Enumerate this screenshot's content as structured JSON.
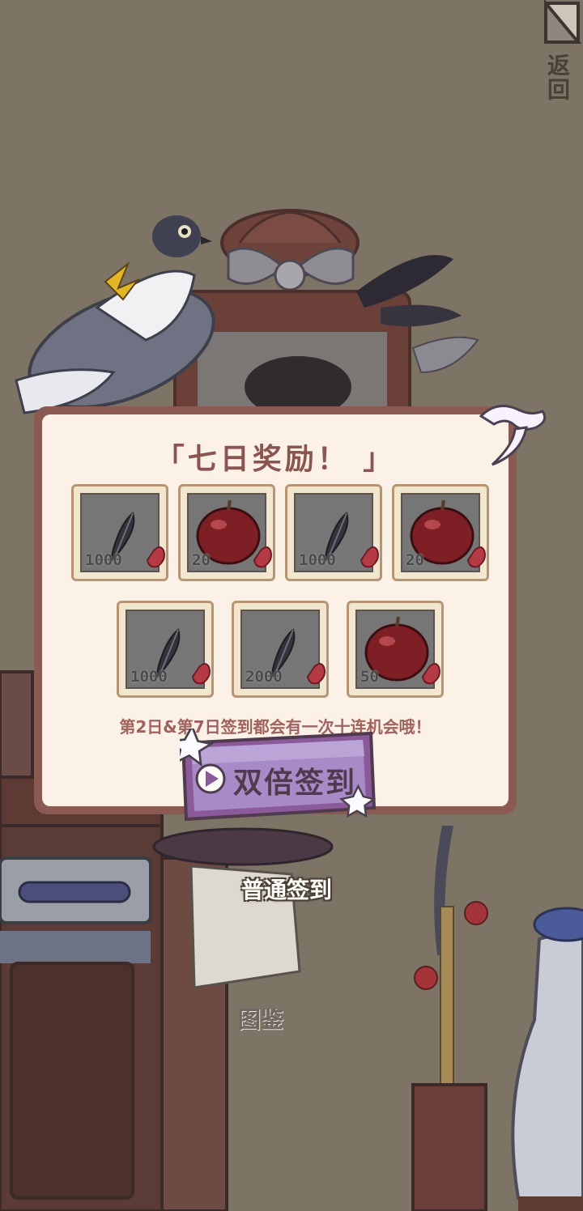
{
  "header": {
    "back_label": "返回",
    "back_icon": "corner-fold-icon"
  },
  "reward_panel": {
    "title": "「七日奖励！ 」",
    "rows": [
      [
        {
          "item": "feather",
          "icon": "feather-icon",
          "qty": "1000"
        },
        {
          "item": "apple",
          "icon": "apple-icon",
          "qty": "20"
        },
        {
          "item": "feather",
          "icon": "feather-icon",
          "qty": "1000"
        },
        {
          "item": "apple",
          "icon": "apple-icon",
          "qty": "20"
        }
      ],
      [
        {
          "item": "feather",
          "icon": "feather-icon",
          "qty": "1000"
        },
        {
          "item": "feather",
          "icon": "feather-icon",
          "qty": "2000"
        },
        {
          "item": "apple",
          "icon": "apple-icon",
          "qty": "50"
        }
      ]
    ],
    "note": "第2日&第7日签到都会有一次十连机会哦！",
    "double_button": {
      "label": "双倍签到",
      "icon": "play-icon",
      "color": "#a88bc6"
    }
  },
  "buttons": {
    "normal_checkin": "普通签到",
    "codex": "图鉴"
  },
  "colors": {
    "background": "#7d7466",
    "panel_frame": "#8a5a53",
    "panel_bg": "#fbf1e6",
    "button_purple": "#a88bc6"
  }
}
